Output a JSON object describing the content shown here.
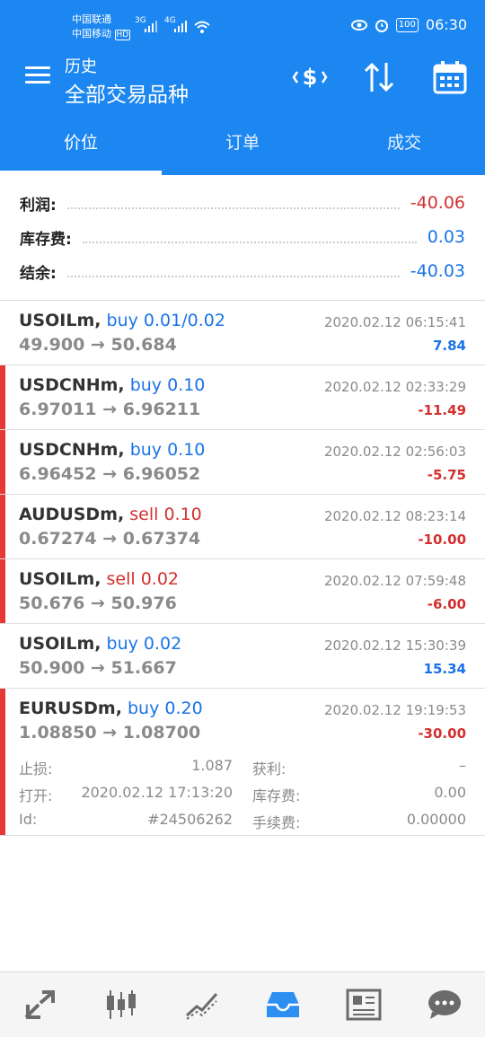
{
  "status_bar": {
    "carrier1": "中国联通",
    "carrier2": "中国移动",
    "hd": "HD",
    "net1": "3G",
    "net2": "4G",
    "battery": "100",
    "time": "06:30"
  },
  "header": {
    "title": "历史",
    "subtitle": "全部交易品种",
    "icons": [
      "currency-sort-icon",
      "sort-arrows-icon",
      "calendar-icon"
    ]
  },
  "tabs": [
    {
      "label": "价位",
      "active": true
    },
    {
      "label": "订单",
      "active": false
    },
    {
      "label": "成交",
      "active": false
    }
  ],
  "summary": {
    "profit_label": "利润:",
    "profit_value": "-40.06",
    "swap_label": "库存费:",
    "swap_value": "0.03",
    "balance_label": "结余:",
    "balance_value": "-40.03"
  },
  "trades": [
    {
      "symbol": "USOILm,",
      "side": "buy 0.01/0.02",
      "type": "buy",
      "prices": "49.900 → 50.684",
      "time": "2020.02.12 06:15:41",
      "pl": "7.84",
      "loss": false
    },
    {
      "symbol": "USDCNHm,",
      "side": "buy 0.10",
      "type": "buy",
      "prices": "6.97011 → 6.96211",
      "time": "2020.02.12 02:33:29",
      "pl": "-11.49",
      "loss": true
    },
    {
      "symbol": "USDCNHm,",
      "side": "buy 0.10",
      "type": "buy",
      "prices": "6.96452 → 6.96052",
      "time": "2020.02.12 02:56:03",
      "pl": "-5.75",
      "loss": true
    },
    {
      "symbol": "AUDUSDm,",
      "side": "sell 0.10",
      "type": "sell",
      "prices": "0.67274 → 0.67374",
      "time": "2020.02.12 08:23:14",
      "pl": "-10.00",
      "loss": true
    },
    {
      "symbol": "USOILm,",
      "side": "sell 0.02",
      "type": "sell",
      "prices": "50.676 → 50.976",
      "time": "2020.02.12 07:59:48",
      "pl": "-6.00",
      "loss": true
    },
    {
      "symbol": "USOILm,",
      "side": "buy 0.02",
      "type": "buy",
      "prices": "50.900 → 51.667",
      "time": "2020.02.12 15:30:39",
      "pl": "15.34",
      "loss": false
    },
    {
      "symbol": "EURUSDm,",
      "side": "buy 0.20",
      "type": "buy",
      "prices": "1.08850 → 1.08700",
      "time": "2020.02.12 19:19:53",
      "pl": "-30.00",
      "loss": true
    }
  ],
  "expanded_detail": {
    "sl_label": "止损:",
    "sl_value": "1.087",
    "tp_label": "获利:",
    "tp_value": "–",
    "open_label": "打开:",
    "open_value": "2020.02.12 17:13:20",
    "swap_label": "库存费:",
    "swap_value": "0.00",
    "id_label": "Id:",
    "id_value": "#24506262",
    "fee_label": "手续费:",
    "fee_value": "0.00000"
  },
  "bottom_nav": [
    "quotes-icon",
    "chart-icon",
    "trade-icon",
    "history-icon",
    "news-icon",
    "chat-icon"
  ],
  "colors": {
    "header": "#1c87f0",
    "positive": "#1a73e8",
    "negative": "#d32f2f",
    "loss_marker": "#e53935",
    "nav_active": "#2d8ff0",
    "nav_inactive": "#6b6b6b"
  }
}
